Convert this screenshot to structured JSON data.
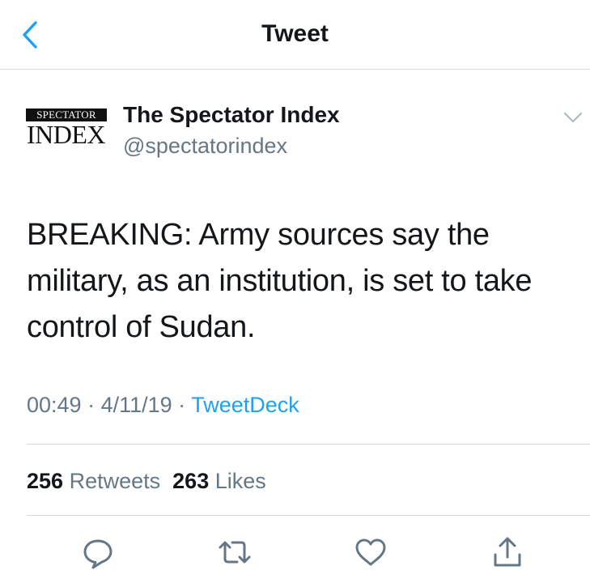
{
  "header": {
    "title": "Tweet",
    "back_icon": "chevron-left-icon"
  },
  "author": {
    "logo_top": "SPECTATOR",
    "logo_bottom": "INDEX",
    "display_name": "The Spectator Index",
    "handle": "@spectatorindex"
  },
  "tweet": {
    "text": "BREAKING: Army sources say the military, as an institution, is set to take control of Sudan."
  },
  "meta": {
    "time": "00:49",
    "sep1": " · ",
    "date": "4/11/19",
    "sep2": " · ",
    "source": "TweetDeck"
  },
  "stats": {
    "retweets_count": "256",
    "retweets_label": "Retweets",
    "likes_count": "263",
    "likes_label": "Likes"
  },
  "actions": [
    {
      "icon": "reply-icon"
    },
    {
      "icon": "retweet-icon"
    },
    {
      "icon": "like-icon"
    },
    {
      "icon": "share-icon"
    }
  ],
  "colors": {
    "accent": "#1da1f2",
    "text": "#14171a",
    "secondary": "#657786",
    "divider": "#d6d9dc"
  }
}
